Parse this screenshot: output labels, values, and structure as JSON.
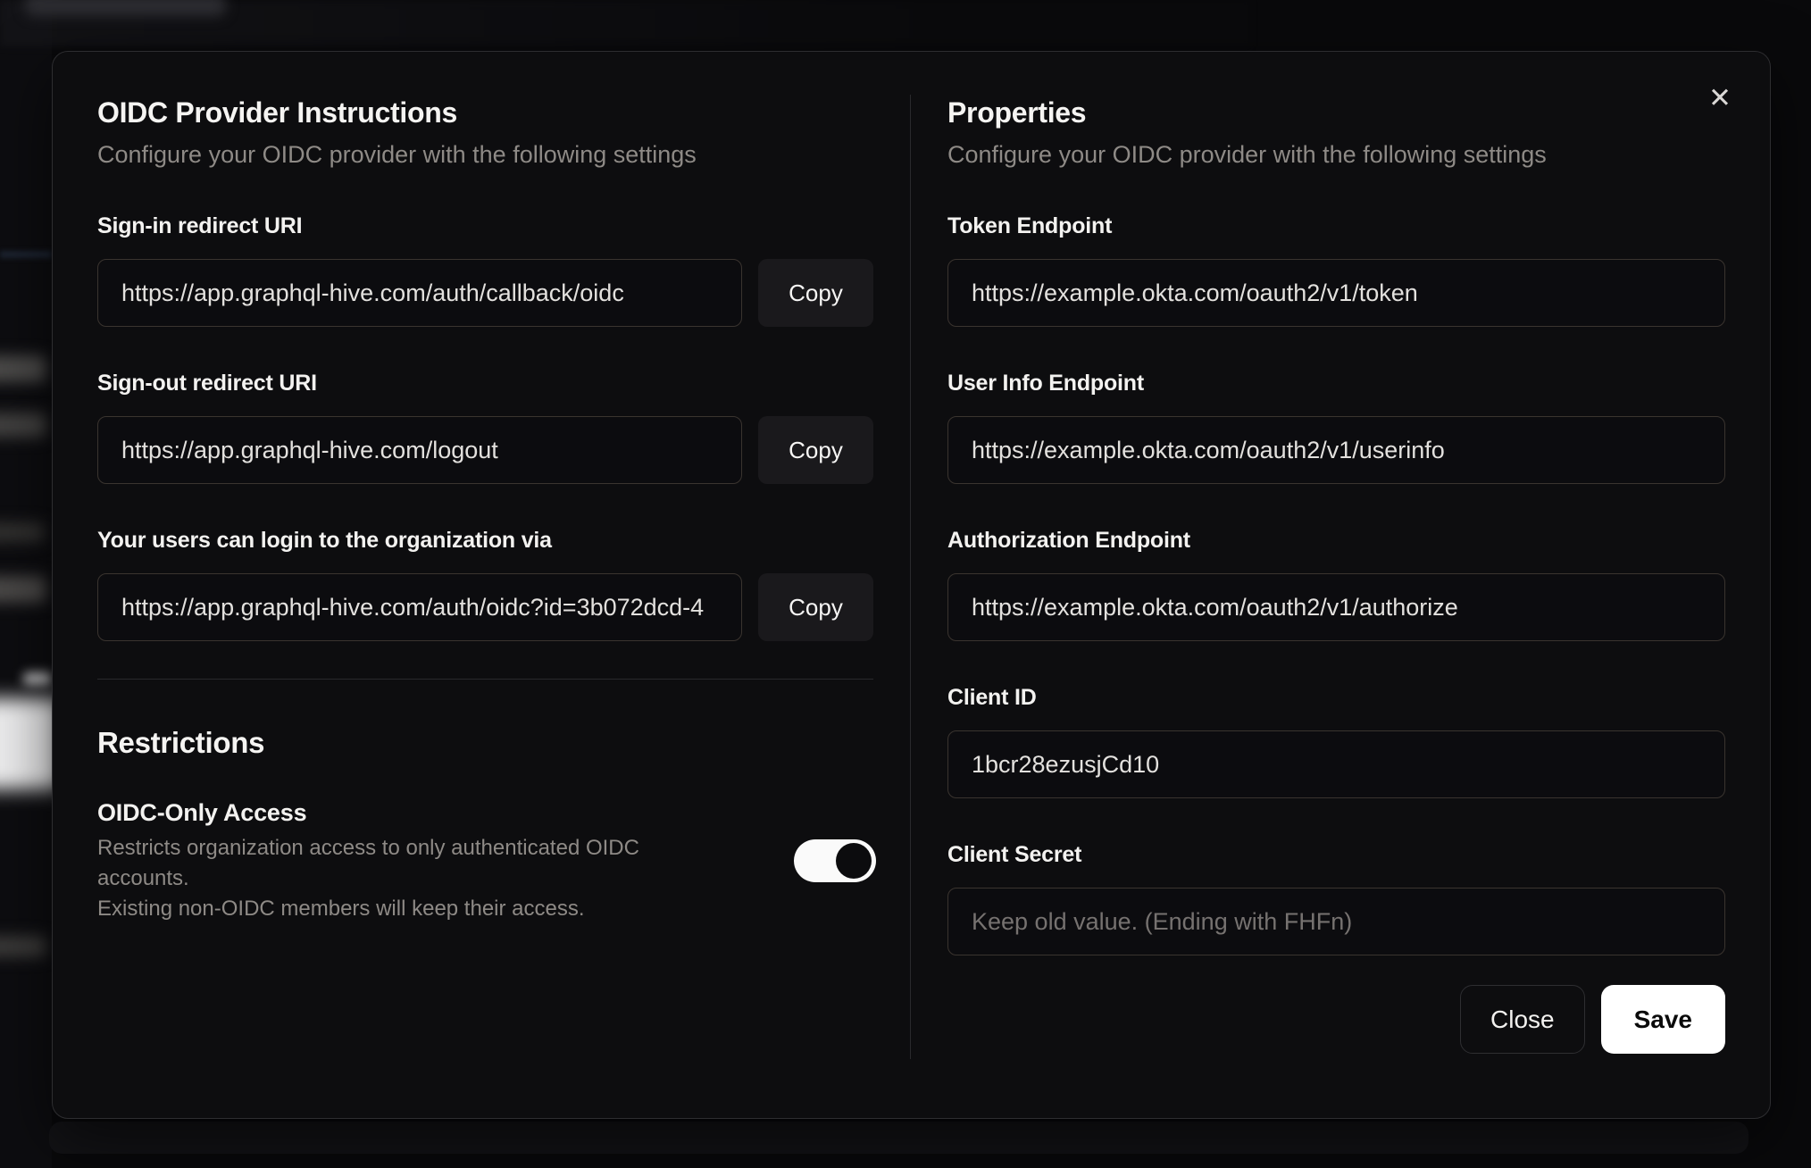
{
  "dialog": {
    "close_icon": "✕",
    "instructions": {
      "title": "OIDC Provider Instructions",
      "subtitle": "Configure your OIDC provider with the following settings",
      "fields": [
        {
          "label": "Sign-in redirect URI",
          "value": "https://app.graphql-hive.com/auth/callback/oidc",
          "copy_label": "Copy"
        },
        {
          "label": "Sign-out redirect URI",
          "value": "https://app.graphql-hive.com/logout",
          "copy_label": "Copy"
        },
        {
          "label": "Your users can login to the organization via",
          "value": "https://app.graphql-hive.com/auth/oidc?id=3b072dcd-4",
          "copy_label": "Copy"
        }
      ]
    },
    "restrictions": {
      "title": "Restrictions",
      "oidc_only": {
        "label": "OIDC-Only Access",
        "description": [
          "Restricts organization access to only authenticated OIDC accounts.",
          "Existing non-OIDC members will keep their access."
        ],
        "enabled": true
      }
    },
    "properties": {
      "title": "Properties",
      "subtitle": "Configure your OIDC provider with the following settings",
      "fields": [
        {
          "label": "Token Endpoint",
          "value": "https://example.okta.com/oauth2/v1/token"
        },
        {
          "label": "User Info Endpoint",
          "value": "https://example.okta.com/oauth2/v1/userinfo"
        },
        {
          "label": "Authorization Endpoint",
          "value": "https://example.okta.com/oauth2/v1/authorize"
        },
        {
          "label": "Client ID",
          "value": "1bcr28ezusjCd10"
        },
        {
          "label": "Client Secret",
          "value": "",
          "placeholder": "Keep old value. (Ending with FHFn)"
        }
      ],
      "footer": {
        "close_label": "Close",
        "save_label": "Save"
      }
    },
    "colors": {
      "modal_bg": "#0d0d0f",
      "input_border": "#3a342f",
      "copy_button_bg": "#1a191c",
      "save_button_bg": "#ffffff",
      "toggle_on": "#fafafa",
      "muted_text": "#8e8a86"
    }
  }
}
